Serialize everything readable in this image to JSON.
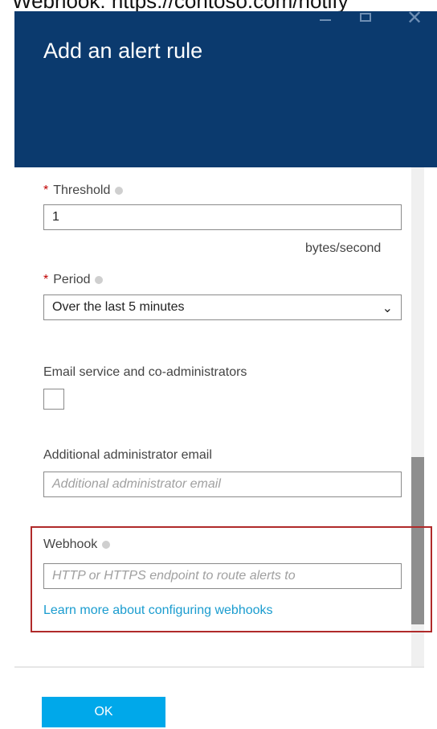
{
  "top_caption": "Webhook: https://contoso.com/notify",
  "window": {
    "title": "Add an alert rule",
    "controls": {
      "minimize_icon": "minimize-icon",
      "maximize_icon": "maximize-icon",
      "close_icon": "close-icon"
    }
  },
  "form": {
    "threshold": {
      "required_mark": "*",
      "label": "Threshold",
      "value": "1",
      "unit": "bytes/second"
    },
    "period": {
      "required_mark": "*",
      "label": "Period",
      "selected": "Over the last 5 minutes"
    },
    "email_service": {
      "label": "Email service and co-administrators",
      "checked": false
    },
    "additional_email": {
      "label": "Additional administrator email",
      "placeholder": "Additional administrator email",
      "value": ""
    },
    "webhook": {
      "label": "Webhook",
      "placeholder": "HTTP or HTTPS endpoint to route alerts to",
      "value": "",
      "help_link": "Learn more about configuring webhooks"
    }
  },
  "footer": {
    "ok_label": "OK"
  },
  "colors": {
    "header_bg": "#0b3a6e",
    "accent": "#00a8ea",
    "link": "#1a9ccf",
    "required": "#c00000",
    "highlight_border": "#b02a2a"
  }
}
